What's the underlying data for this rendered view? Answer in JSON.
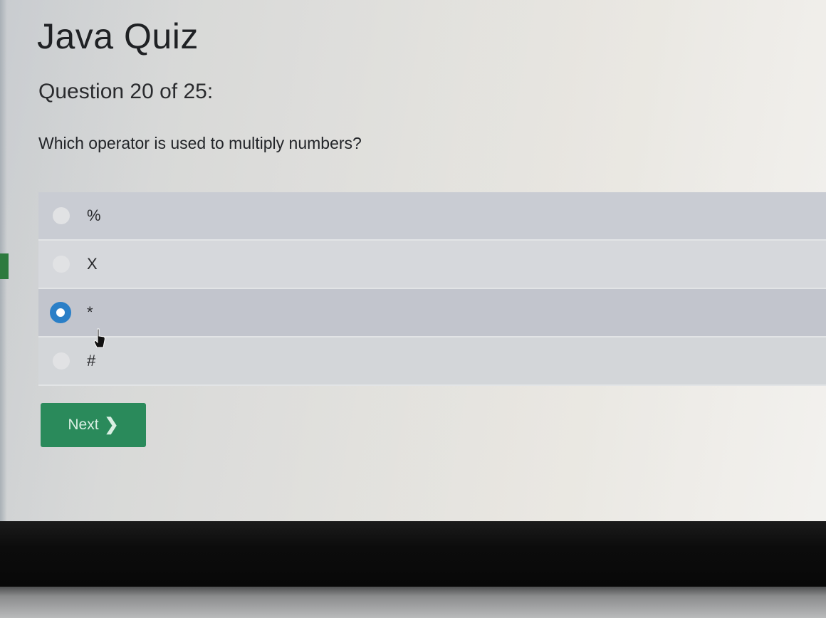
{
  "quiz": {
    "title": "Java Quiz",
    "counter": "Question 20 of 25:",
    "question": "Which operator is used to multiply numbers?"
  },
  "options": [
    {
      "label": "%",
      "selected": false
    },
    {
      "label": "X",
      "selected": false
    },
    {
      "label": "*",
      "selected": true
    },
    {
      "label": "#",
      "selected": false
    }
  ],
  "next_button": {
    "label": "Next",
    "icon": "chevron-right-icon",
    "color": "#2a8a5b"
  },
  "accent": {
    "radio_selected": "#2a7fc7"
  }
}
